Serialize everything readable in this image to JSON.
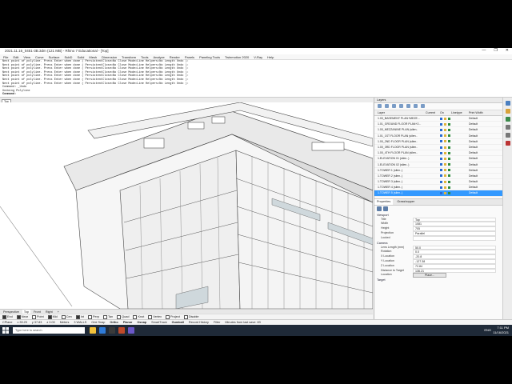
{
  "window": {
    "title": "2021.11.16_0451-3B.3dm (121 MB) - Rhino 7 Educational - [Top]",
    "controls": [
      "—",
      "❐",
      "✕"
    ]
  },
  "menu": [
    "File",
    "Edit",
    "View",
    "Curve",
    "Surface",
    "SubD",
    "Solid",
    "Mesh",
    "Dimension",
    "Transform",
    "Tools",
    "Analyze",
    "Render",
    "Panels",
    "Paneling Tools",
    "Twinmotion 2020",
    "V-Ray",
    "Help"
  ],
  "command_history": [
    "Next point of polyline. Press Enter when done ( PersistentClose=No  Close  Mode=Line  Helpers=No  Length  Undo ):",
    "Next point of polyline. Press Enter when done ( PersistentClose=No  Close  Mode=Line  Helpers=No  Length  Undo ):",
    "Next point of polyline. Press Enter when done ( PersistentClose=No  Close  Mode=Line  Helpers=No  Length  Undo ):",
    "Next point of polyline. Press Enter when done ( PersistentClose=No  Close  Mode=Line  Helpers=No  Length  Undo ):",
    "Next point of polyline. Press Enter when done ( PersistentClose=No  Close  Mode=Line  Helpers=No  Length  Undo ):",
    "Next point of polyline. Press Enter when done ( PersistentClose=No  Close  Mode=Line  Helpers=No  Length  Undo ):",
    "Next point of polyline. Press Enter when done ( PersistentClose=No  Close  Mode=Line  Helpers=No  Length  Undo ):",
    "Command: _Undo",
    "Undoing Polyline"
  ],
  "command_prompt": "Command:",
  "viewport": {
    "active_label": "Top"
  },
  "viewport_tabs": [
    "Perspective",
    "Top",
    "Front",
    "Right"
  ],
  "viewport_tab_add": "+",
  "osnaps": [
    {
      "label": "End",
      "on": true
    },
    {
      "label": "Near",
      "on": true
    },
    {
      "label": "Point",
      "on": false
    },
    {
      "label": "Mid",
      "on": true
    },
    {
      "label": "Cen",
      "on": false
    },
    {
      "label": "Int",
      "on": true
    },
    {
      "label": "Perp",
      "on": false
    },
    {
      "label": "Tan",
      "on": false
    },
    {
      "label": "Quad",
      "on": false
    },
    {
      "label": "Knot",
      "on": false
    },
    {
      "label": "Vertex",
      "on": false
    },
    {
      "label": "Project",
      "on": false
    },
    {
      "label": "Disable",
      "on": false
    }
  ],
  "status": {
    "cplane": "CPlane",
    "x": "x 39.29",
    "y": "y 37.83",
    "z": "z 0.00",
    "units": "Meters",
    "layer": "3 WALLS",
    "toggles": [
      "Grid Snap",
      "Ortho",
      "Planar",
      "Osnap",
      "SmartTrack",
      "Gumball",
      "Record History",
      "Filter"
    ],
    "message": "Minutes from last save: 83"
  },
  "layers_panel": {
    "title": "Layers",
    "columns": [
      "Layer",
      "Current",
      "On",
      "Linetype",
      "Print Width"
    ],
    "rows": [
      {
        "name": "1.00_BASEMENT PLAN+MEZE...",
        "print": "Default"
      },
      {
        "name": "1.01_GROUND FLOOR PLAN+2...",
        "print": "Default"
      },
      {
        "name": "1.00_MEZZANINE PLAN (silen..",
        "print": "Default"
      },
      {
        "name": "1.01_1ST FLOOR PLAN (silen..",
        "print": "Default"
      },
      {
        "name": "1.00_2ND FLOOR PLAN (silen..",
        "print": "Default"
      },
      {
        "name": "1.00_3RD FLOOR PLAN (silen..",
        "print": "Default"
      },
      {
        "name": "1.00_4TH FLOOR PLAN (silen..",
        "print": "Default"
      },
      {
        "name": "1.ELEVATION 01 (silen..)",
        "print": "Default"
      },
      {
        "name": "1.ELEVATION 02 (silen..)",
        "print": "Default"
      },
      {
        "name": "1.TOWER 1 (silen..)",
        "print": "Default"
      },
      {
        "name": "1.TOWER 2 (silen..)",
        "print": "Default"
      },
      {
        "name": "1.TOWER 3 (silen..)",
        "print": "Default"
      },
      {
        "name": "1.TOWER 4 (silen..)",
        "print": "Default"
      },
      {
        "name": "1.TOWER 5 (silen..)",
        "print": "Default"
      }
    ],
    "selected_index": 13
  },
  "properties_panel": {
    "tabs": [
      "Properties",
      "Grasshopper"
    ],
    "sections": {
      "viewport": "Viewport",
      "camera": "Camera",
      "target": "Target"
    },
    "viewport_rows": [
      {
        "k": "Title",
        "v": "Top"
      },
      {
        "k": "Width",
        "v": "1081"
      },
      {
        "k": "Height",
        "v": "705"
      },
      {
        "k": "Projection",
        "v": "Parallel"
      },
      {
        "k": "Locked",
        "v": ""
      }
    ],
    "camera_rows": [
      {
        "k": "Lens Length (mm)",
        "v": "50.0"
      },
      {
        "k": "Rotation",
        "v": "0.0"
      },
      {
        "k": "X Location",
        "v": "-20.8"
      },
      {
        "k": "Y Location",
        "v": "-127.38"
      },
      {
        "k": "Z Location",
        "v": "72.84"
      },
      {
        "k": "Distance to Target",
        "v": "136.21"
      },
      {
        "k": "Location",
        "v": "Place..."
      }
    ]
  },
  "taskbar": {
    "search_placeholder": "Type here to search",
    "lang": "ENG",
    "time": "7:11 PM",
    "date": "11/16/2021"
  },
  "colors": {
    "selected_row": "#3399ff",
    "taskbar": "#1f2a38",
    "accent_blue": "#0078d7"
  }
}
